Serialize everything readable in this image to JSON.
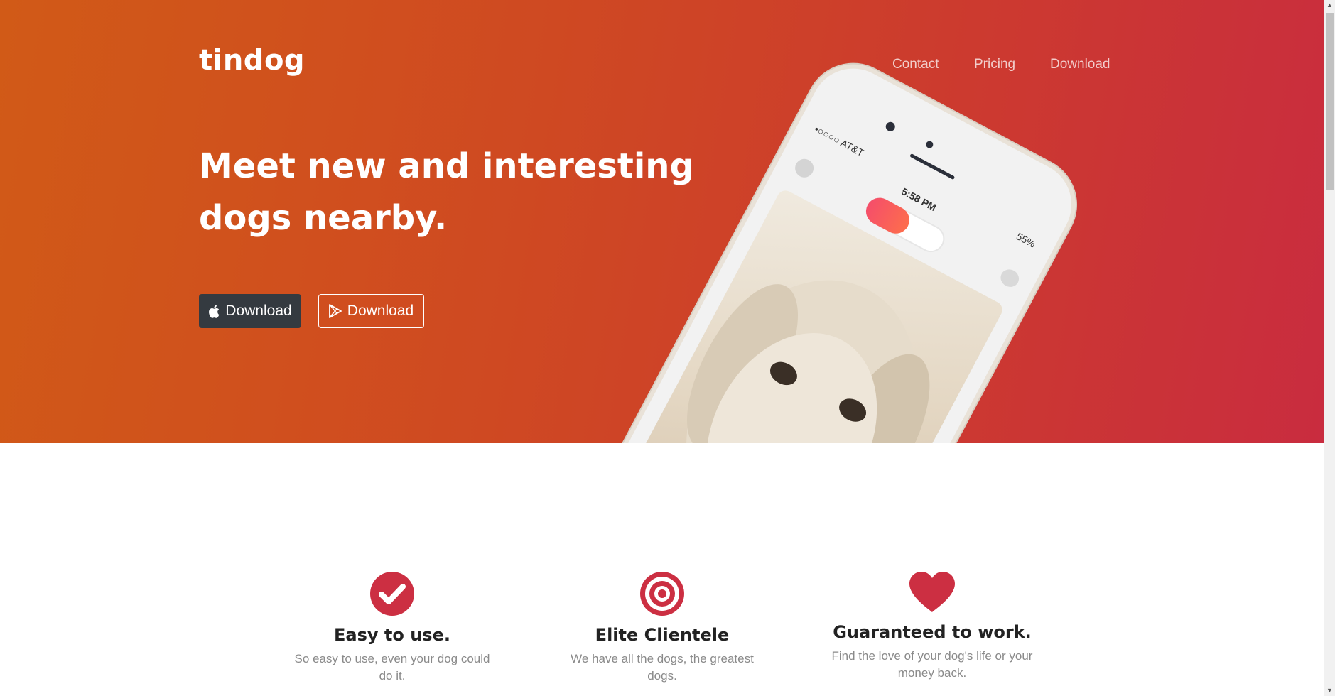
{
  "brand": {
    "name": "tindog"
  },
  "nav": {
    "items": [
      {
        "label": "Contact"
      },
      {
        "label": "Pricing"
      },
      {
        "label": "Download"
      }
    ]
  },
  "hero": {
    "headline": "Meet new and interesting dogs nearby.",
    "buttons": [
      {
        "label": "Download",
        "icon": "apple-icon",
        "style": "dark"
      },
      {
        "label": "Download",
        "icon": "google-play-icon",
        "style": "outline"
      }
    ],
    "phone": {
      "carrier": "•○○○○ AT&T",
      "time": "5:58 PM",
      "battery": "55%"
    }
  },
  "features": [
    {
      "icon": "check-circle-icon",
      "title": "Easy to use.",
      "text": "So easy to use, even your dog could do it."
    },
    {
      "icon": "bullseye-icon",
      "title": "Elite Clientele",
      "text": "We have all the dogs, the greatest dogs."
    },
    {
      "icon": "heart-icon",
      "title": "Guaranteed to work.",
      "text": "Find the love of your dog's life or your money back."
    }
  ],
  "colors": {
    "accent": "#cc2f42",
    "hero_gradient_start": "#d15a17",
    "hero_gradient_end": "#c92c3f",
    "dark_button": "#343a40"
  }
}
